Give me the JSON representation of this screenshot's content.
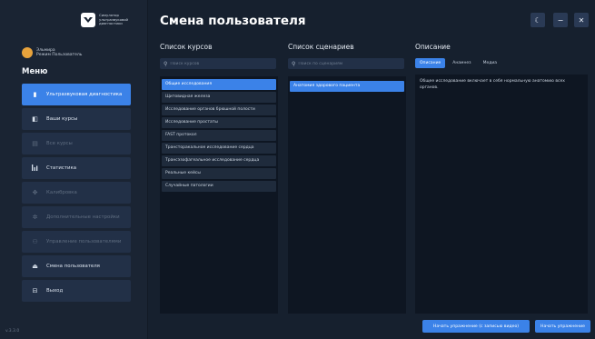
{
  "app": {
    "logo_text": "Симулятор ультразвуковой диагностики",
    "user_name": "Эльмира",
    "user_mode": "Режим Пользователь",
    "version": "v.3.3.0"
  },
  "sidebar": {
    "menu_title": "Меню",
    "items": [
      {
        "label": "Ультразвуковая диагностика",
        "icon": "ultrasound-icon",
        "state": "active"
      },
      {
        "label": "Ваши курсы",
        "icon": "book-icon",
        "state": "normal"
      },
      {
        "label": "Все курсы",
        "icon": "courses-icon",
        "state": "disabled"
      },
      {
        "label": "Статистика",
        "icon": "chart-icon",
        "state": "normal"
      },
      {
        "label": "Калибровка",
        "icon": "calibration-icon",
        "state": "disabled"
      },
      {
        "label": "Дополнительные настройки",
        "icon": "settings-icon",
        "state": "disabled"
      },
      {
        "label": "Управление пользователями",
        "icon": "users-icon",
        "state": "disabled"
      },
      {
        "label": "Смена пользователя",
        "icon": "user-switch-icon",
        "state": "normal"
      },
      {
        "label": "Выход",
        "icon": "exit-icon",
        "state": "normal"
      }
    ]
  },
  "header": {
    "title": "Смена пользователя",
    "theme_icon": "moon-icon",
    "minimize_icon": "minimize-icon",
    "close_icon": "close-icon"
  },
  "courses": {
    "title": "Список курсов",
    "search_placeholder": "Поиск курсов",
    "items": [
      "Общие исследования",
      "Щитовидная железа",
      "Исследование органов брюшной полости",
      "Исследование простаты",
      "FAST протокол",
      "Трансторакальное исследование сердца",
      "Трансэзофагеальное исследование сердца",
      "Реальные кейсы",
      "Случайные патологии"
    ],
    "selected_index": 0
  },
  "scenarios": {
    "title": "Список сценариев",
    "search_placeholder": "Поиск по сценариям",
    "items": [
      "Анатомия здорового пациента"
    ],
    "selected_index": 0
  },
  "description": {
    "title": "Описание",
    "tabs": [
      "Описание",
      "Анамнез",
      "Медиа"
    ],
    "active_tab": 0,
    "text": "Общее исследование включает в себя нормальную анатомию всех органов."
  },
  "actions": {
    "start_with_video": "Начать упражнение (с записью видео)",
    "start": "Начать упражнение"
  },
  "colors": {
    "accent": "#3b82e8",
    "background": "#16202e",
    "panel": "#0e1622",
    "nav_item": "#223047"
  }
}
